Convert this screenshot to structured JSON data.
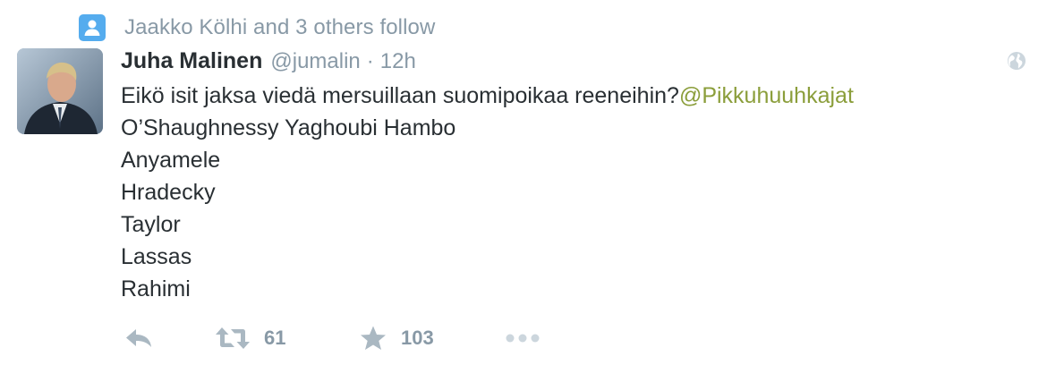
{
  "context": {
    "text": "Jaakko Kölhi and 3 others follow",
    "icon": "person-icon",
    "icon_color": "#55acee"
  },
  "tweet": {
    "author": {
      "name": "Juha Malinen",
      "handle": "@jumalin",
      "avatar": "avatar"
    },
    "separator": "·",
    "time": "12h",
    "visibility_icon": "globe-icon",
    "text_main": "Eikö isit jaksa viedä mersuillaan suomipoikaa reeneihin?",
    "mention": "@Pikkuhuuhkajat",
    "mention_color": "#8b9e3b",
    "names": [
      "O’Shaughnessy Yaghoubi Hambo",
      "Anyamele",
      "Hradecky",
      "Taylor",
      "Lassas",
      "Rahimi"
    ]
  },
  "actions": {
    "reply": {
      "icon": "reply-icon"
    },
    "retweet": {
      "icon": "retweet-icon",
      "count": "61"
    },
    "favorite": {
      "icon": "star-icon",
      "count": "103"
    },
    "more": {
      "icon": "more-dots-icon"
    }
  },
  "colors": {
    "text": "#292f33",
    "muted": "#8899a6",
    "icon_muted": "#aab8c2"
  }
}
